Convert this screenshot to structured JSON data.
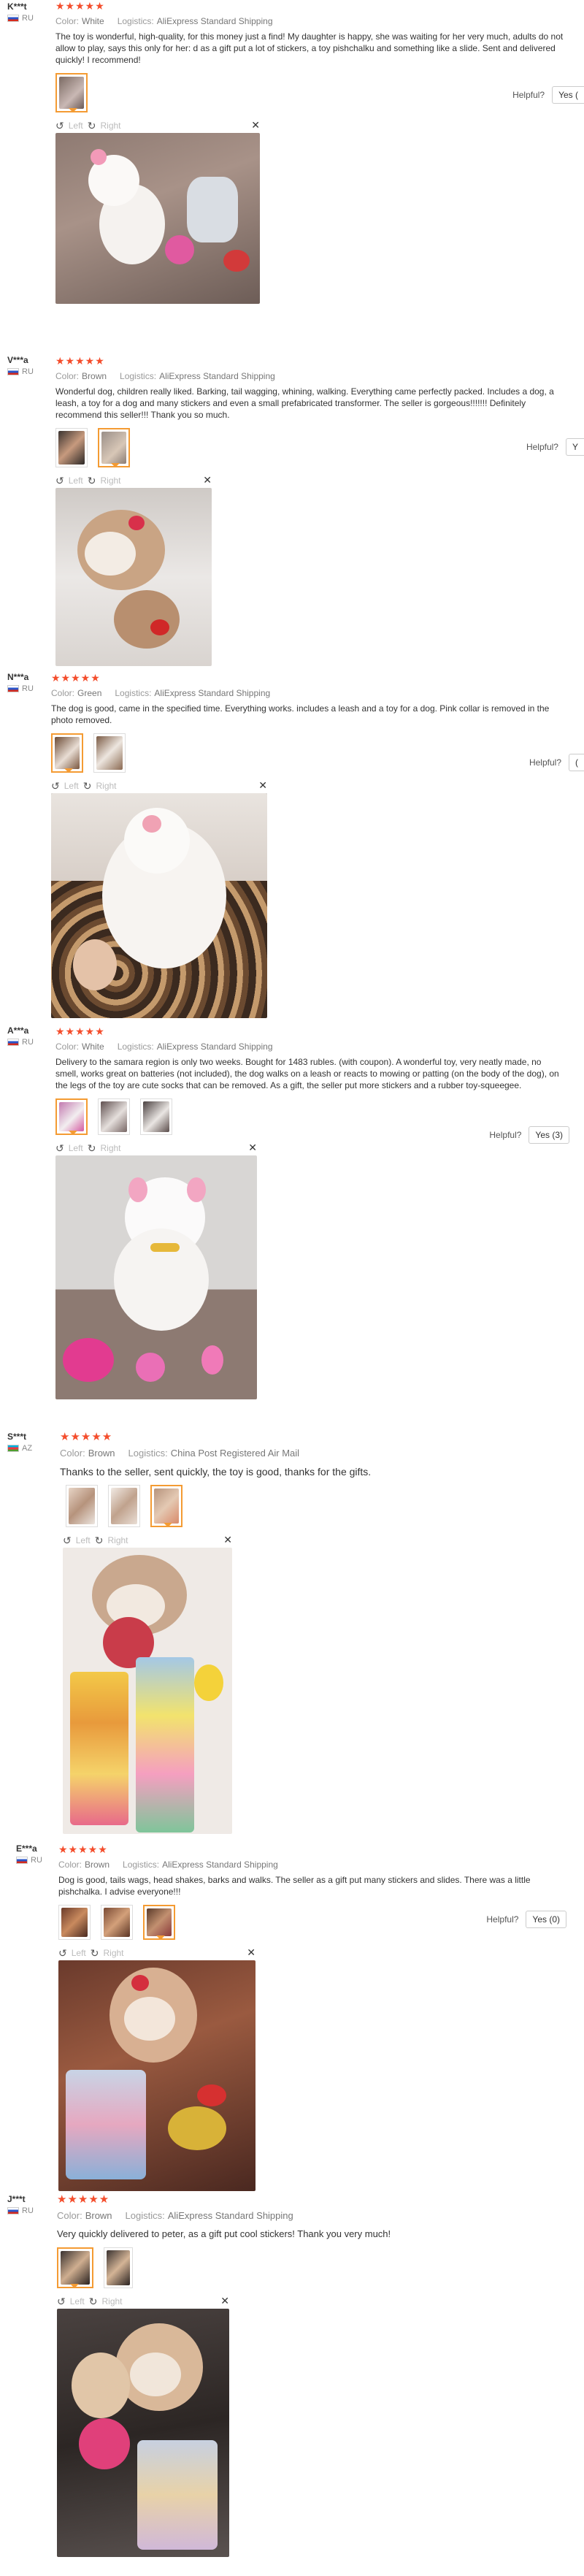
{
  "labels": {
    "color": "Color:",
    "logistics": "Logistics:",
    "helpful": "Helpful?",
    "left": "Left",
    "right": "Right"
  },
  "colors": {
    "star": "#f44d2c",
    "selected": "#f49b33"
  },
  "reviews": [
    {
      "user": "K***t",
      "country": "RU",
      "stars": "★★★★★",
      "color": "White",
      "logistics": "AliExpress Standard Shipping",
      "text": "The toy is wonderful, high-quality, for this money just a find! My daughter is happy, she was waiting for her very much, adults do not allow to play, says this only for her: d as a gift put a lot of stickers, a toy pishchalku and something like a slide. Sent and delivered quickly! I recommend!",
      "helpful_yes": "Yes ("
    },
    {
      "user": "V***a",
      "country": "RU",
      "stars": "★★★★★",
      "color": "Brown",
      "logistics": "AliExpress Standard Shipping",
      "text": "Wonderful dog, children really liked. Barking, tail wagging, whining, walking. Everything came perfectly packed. Includes a dog, a leash, a toy for a dog and many stickers and even a small prefabricated transformer. The seller is gorgeous!!!!!!! Definitely recommend this seller!!! Thank you so much.",
      "helpful_yes": "Y"
    },
    {
      "user": "N***a",
      "country": "RU",
      "stars": "★★★★★",
      "color": "Green",
      "logistics": "AliExpress Standard Shipping",
      "text": "The dog is good, came in the specified time. Everything works. includes a leash and a toy for a dog. Pink collar is removed in the photo removed.",
      "helpful_yes": "("
    },
    {
      "user": "A***a",
      "country": "RU",
      "stars": "★★★★★",
      "color": "White",
      "logistics": "AliExpress Standard Shipping",
      "text": "Delivery to the samara region is only two weeks. Bought for 1483 rubles. (with coupon). A wonderful toy, very neatly made, no smell, works great on batteries (not included), the dog walks on a leash or reacts to mowing or patting (on the body of the dog), on the legs of the toy are cute socks that can be removed. As a gift, the seller put more stickers and a rubber toy-squeegee.",
      "helpful_yes": "Yes (3)"
    },
    {
      "user": "S***t",
      "country": "AZ",
      "stars": "★★★★★",
      "color": "Brown",
      "logistics": "China Post Registered Air Mail",
      "text": "Thanks to the seller, sent quickly, the toy is good, thanks for the gifts."
    },
    {
      "user": "E***a",
      "country": "RU",
      "stars": "★★★★★",
      "color": "Brown",
      "logistics": "AliExpress Standard Shipping",
      "text": "Dog is good, tails wags, head shakes, barks and walks. The seller as a gift put many stickers and slides. There was a little pishchalka. I advise everyone!!!",
      "helpful_yes": "Yes (0)"
    },
    {
      "user": "J***t",
      "country": "RU",
      "stars": "★★★★★",
      "color": "Brown",
      "logistics": "AliExpress Standard Shipping",
      "text": "Very quickly delivered to peter, as a gift put cool stickers! Thank you very much!"
    }
  ]
}
